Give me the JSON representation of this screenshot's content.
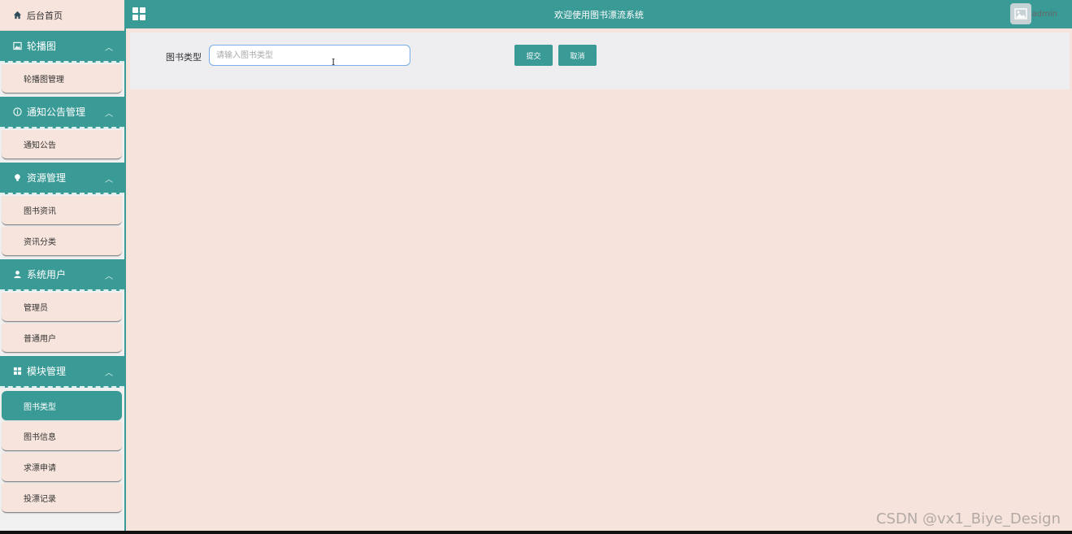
{
  "sidebar": {
    "home_label": "后台首页",
    "groups": [
      {
        "label": "轮播图",
        "icon": "image-icon",
        "items": [
          {
            "label": "轮播图管理"
          }
        ]
      },
      {
        "label": "通知公告管理",
        "icon": "info-icon",
        "items": [
          {
            "label": "通知公告"
          }
        ]
      },
      {
        "label": "资源管理",
        "icon": "bulb-icon",
        "items": [
          {
            "label": "图书资讯"
          },
          {
            "label": "资讯分类"
          }
        ]
      },
      {
        "label": "系统用户",
        "icon": "user-icon",
        "items": [
          {
            "label": "管理员"
          },
          {
            "label": "普通用户"
          }
        ]
      },
      {
        "label": "模块管理",
        "icon": "grid-icon",
        "items": [
          {
            "label": "图书类型",
            "active": true
          },
          {
            "label": "图书信息"
          },
          {
            "label": "求漂申请"
          },
          {
            "label": "投漂记录"
          }
        ]
      }
    ]
  },
  "header": {
    "title": "欢迎使用图书漂流系统",
    "username": "admin"
  },
  "form": {
    "field_label": "图书类型",
    "field_placeholder": "请输入图书类型",
    "field_value": "",
    "submit_label": "提交",
    "cancel_label": "取消"
  },
  "watermark": "CSDN @vx1_Biye_Design",
  "colors": {
    "accent": "#3a9a96",
    "background": "#f6e4dc",
    "panel": "#eeedf0"
  }
}
